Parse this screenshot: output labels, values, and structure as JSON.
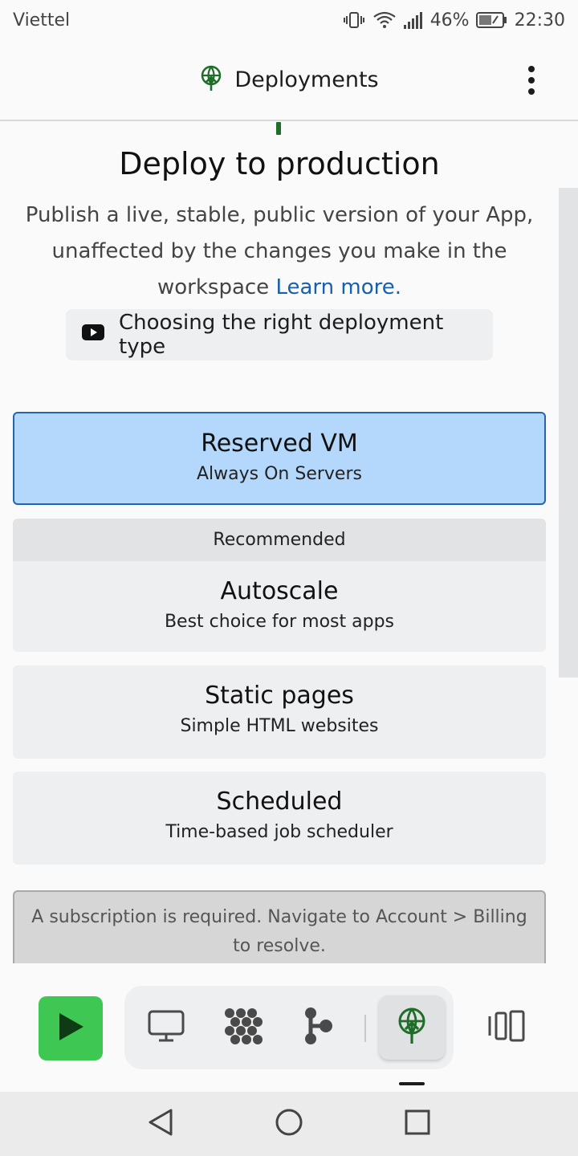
{
  "status_bar": {
    "carrier": "Viettel",
    "battery": "46%",
    "time": "22:30"
  },
  "header": {
    "title": "Deployments",
    "icon": "deploy-icon"
  },
  "main": {
    "title": "Deploy to production",
    "description": "Publish a live, stable, public version of your App, unaffected by the changes you make in the workspace",
    "learn_more": "Learn more.",
    "video_chip": "Choosing the right deployment type"
  },
  "deployment_types": [
    {
      "title": "Reserved VM",
      "subtitle": "Always On Servers",
      "selected": true
    },
    {
      "badge": "Recommended",
      "title": "Autoscale",
      "subtitle": "Best choice for most apps",
      "selected": false
    },
    {
      "title": "Static pages",
      "subtitle": "Simple HTML websites",
      "selected": false
    },
    {
      "title": "Scheduled",
      "subtitle": "Time-based job scheduler",
      "selected": false
    }
  ],
  "notice": "A subscription is required. Navigate to Account > Billing to resolve.",
  "toolbar": {
    "icons": [
      "play-icon",
      "monitor-icon",
      "packages-icon",
      "git-icon",
      "deploy-icon",
      "panels-icon"
    ]
  },
  "colors": {
    "selected_bg": "#b4d8fb",
    "selected_border": "#2466ad",
    "run_green": "#3ec853",
    "deploy_green": "#1e6e2a",
    "link_blue": "#1760b0"
  }
}
